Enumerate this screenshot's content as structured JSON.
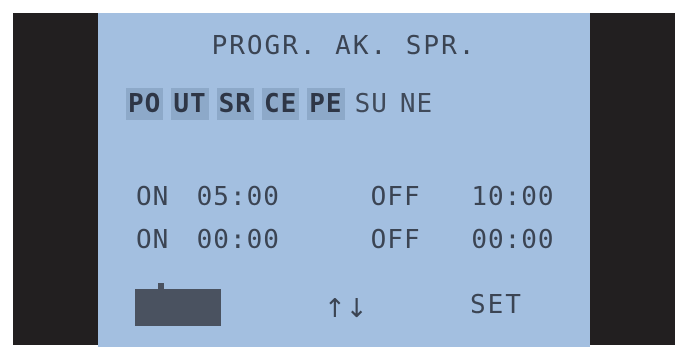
{
  "screen": {
    "title": "PROGR.  AK.  SPR."
  },
  "days": [
    {
      "label": "PO",
      "selected": true
    },
    {
      "label": "UT",
      "selected": true
    },
    {
      "label": "SR",
      "selected": true
    },
    {
      "label": "CE",
      "selected": true
    },
    {
      "label": "PE",
      "selected": true
    },
    {
      "label": "SU",
      "selected": false
    },
    {
      "label": "NE",
      "selected": false
    }
  ],
  "schedule": [
    {
      "on_label": "ON",
      "on_time": "05:00",
      "off_label": "OFF",
      "off_time": "10:00"
    },
    {
      "on_label": "ON",
      "on_time": "00:00",
      "off_label": "OFF",
      "off_time": "00:00"
    }
  ],
  "footer": {
    "arrows_label": "↑↓",
    "set_label": "SET"
  },
  "colors": {
    "lcd_background": "#a3bfe0",
    "lcd_text": "#3b4453",
    "day_highlight": "#8da9c9",
    "bezel": "#221f20",
    "cursor_block": "#4a5260"
  },
  "icons": {
    "arrows": "up-down-arrows-icon"
  }
}
